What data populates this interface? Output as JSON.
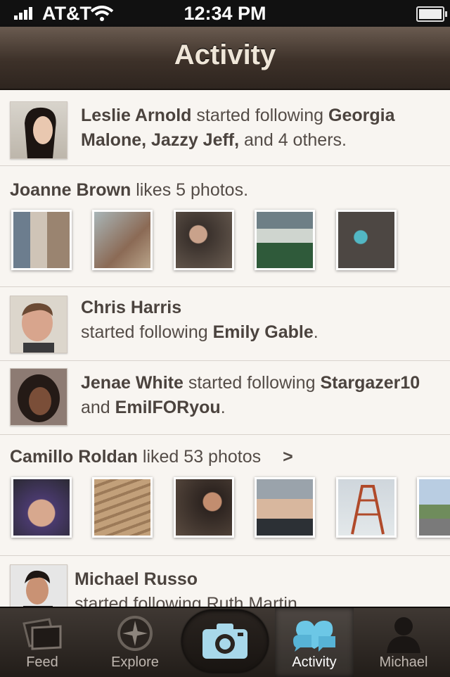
{
  "status": {
    "carrier": "AT&T",
    "time": "12:34 PM"
  },
  "nav": {
    "title": "Activity"
  },
  "rows": [
    {
      "kind": "follow",
      "user": "Leslie Arnold",
      "verb": "started following",
      "targets": "Georgia Malone, Jazzy Jeff,",
      "tail": "and 4 others."
    },
    {
      "kind": "likes",
      "user": "Joanne Brown",
      "verb": "likes 5 photos."
    },
    {
      "kind": "follow",
      "user": "Chris Harris",
      "verb": "started following",
      "targets": "Emily Gable",
      "tail": "."
    },
    {
      "kind": "follow",
      "user": "Jenae White",
      "verb": "started following",
      "targets": "Stargazer10",
      "mid": "and",
      "targets2": "EmilFORyou",
      "tail": "."
    },
    {
      "kind": "likes",
      "user": "Camillo Roldan",
      "verb": "liked 53 photos",
      "chevron": ">"
    },
    {
      "kind": "follow",
      "user": "Michael Russo",
      "verb": "started following Ruth Martin"
    }
  ],
  "tabs": [
    {
      "label": "Feed",
      "icon": "feed-icon"
    },
    {
      "label": "Explore",
      "icon": "compass-icon"
    },
    {
      "label": "",
      "icon": "camera-icon"
    },
    {
      "label": "Activity",
      "icon": "activity-icon"
    },
    {
      "label": "Michael",
      "icon": "profile-icon"
    }
  ],
  "colors": {
    "navbar": "#3d3129",
    "tabbar": "#2a2420",
    "accent": "#6cc7e6",
    "text": "#4a4340"
  }
}
